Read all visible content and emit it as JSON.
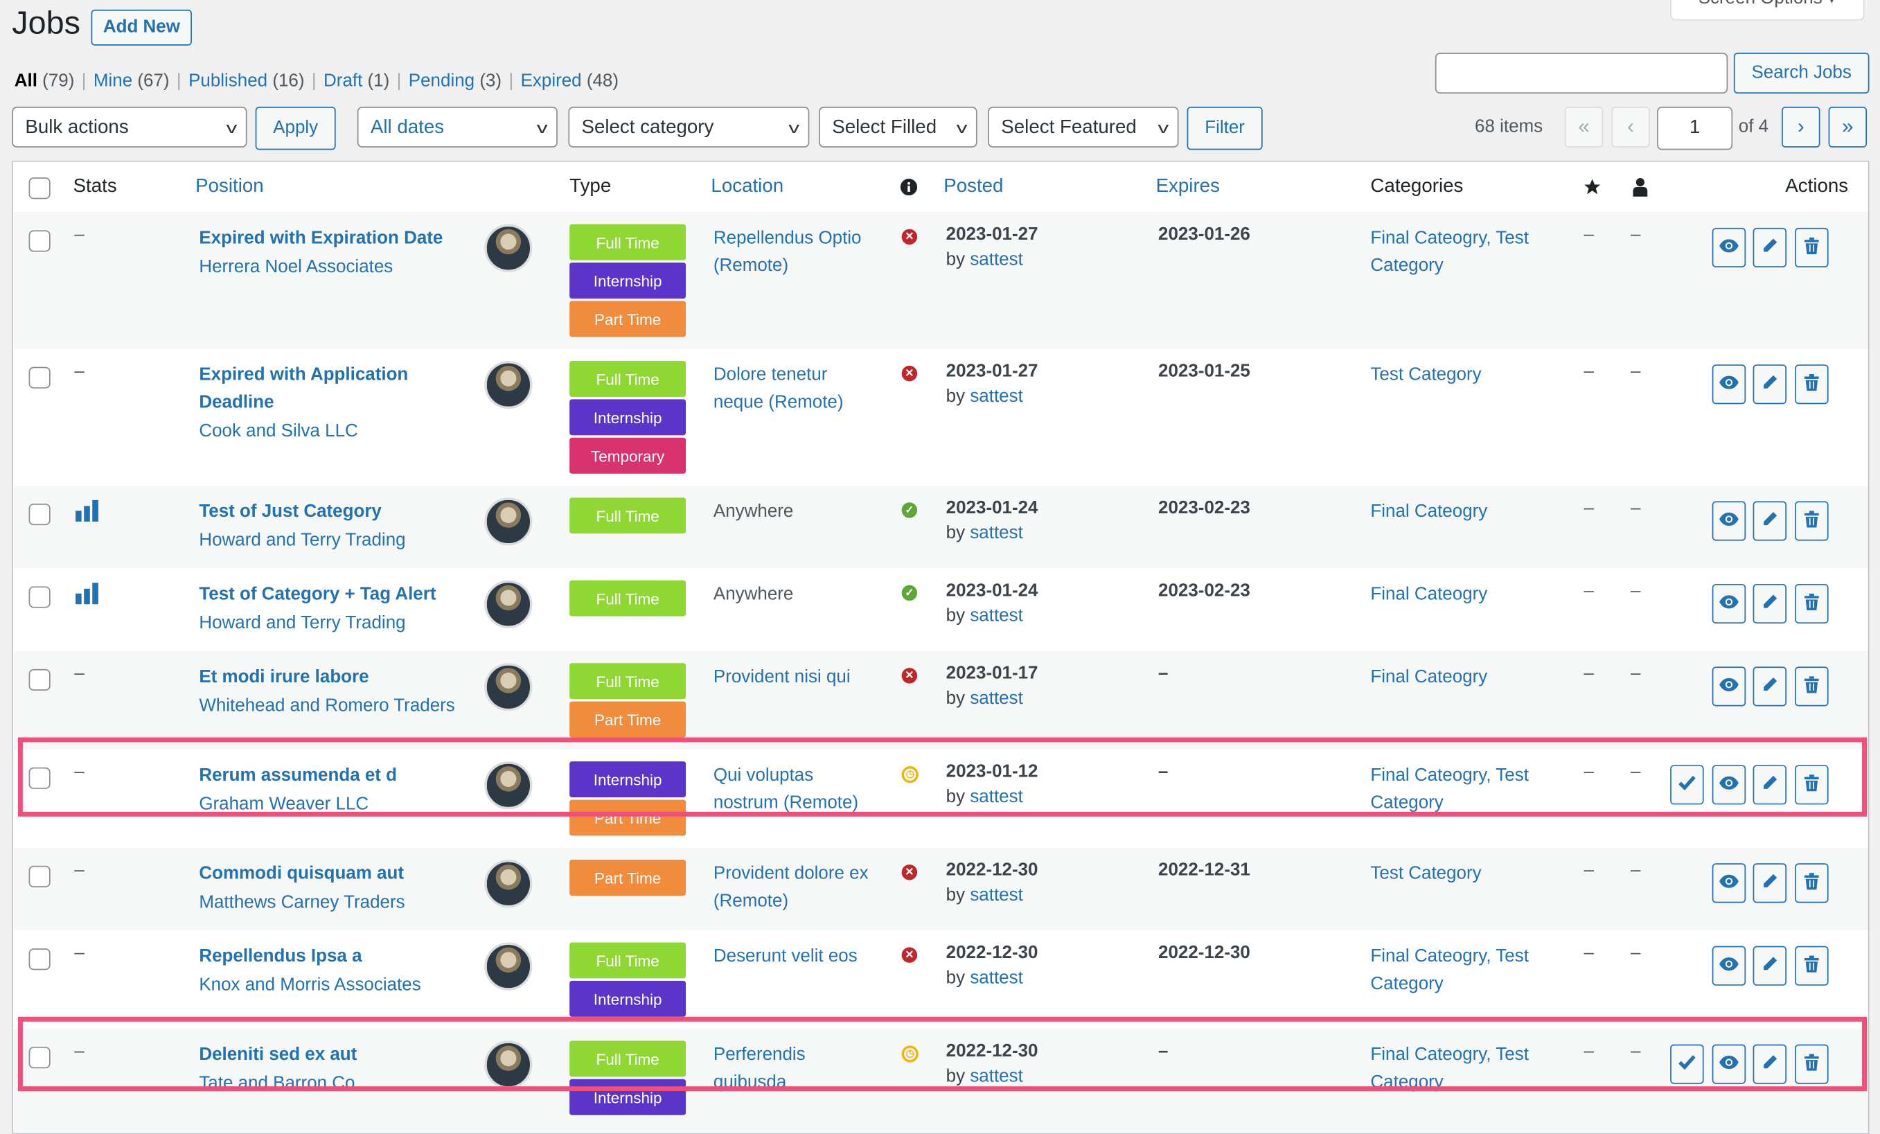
{
  "header": {
    "title": "Jobs",
    "add_new": "Add New",
    "screen_options": "Screen Options ▾"
  },
  "views": [
    {
      "label": "All",
      "count": "(79)",
      "current": true
    },
    {
      "label": "Mine",
      "count": "(67)"
    },
    {
      "label": "Published",
      "count": "(16)"
    },
    {
      "label": "Draft",
      "count": "(1)"
    },
    {
      "label": "Pending",
      "count": "(3)"
    },
    {
      "label": "Expired",
      "count": "(48)"
    }
  ],
  "search": {
    "value": "",
    "button": "Search Jobs"
  },
  "filters": {
    "bulk_actions": "Bulk actions",
    "apply": "Apply",
    "dates": "All dates",
    "category": "Select category",
    "filled": "Select Filled",
    "featured": "Select Featured",
    "filter": "Filter"
  },
  "pagination": {
    "items": "68 items",
    "first": "«",
    "prev": "‹",
    "current_page": "1",
    "of": "of 4",
    "next": "›",
    "last": "»"
  },
  "columns": {
    "stats": "Stats",
    "position": "Position",
    "type": "Type",
    "location": "Location",
    "status_icon": "info-icon",
    "posted": "Posted",
    "expires": "Expires",
    "categories": "Categories",
    "featured_icon": "star-icon",
    "filled_icon": "person-icon",
    "actions": "Actions"
  },
  "type_colors": {
    "Full Time": "#8fd834",
    "Internship": "#5b34c9",
    "Part Time": "#f08c3c",
    "Temporary": "#d9336f"
  },
  "status_colors": {
    "expired": "#c1262a",
    "active": "#5ea63a",
    "pending": "#f0b30a"
  },
  "highlight_color": "#ef4f79",
  "rows": [
    {
      "stats": "dash",
      "title": "Expired with Expiration Date",
      "company": "Herrera Noel Associates",
      "types": [
        "Full Time",
        "Internship",
        "Part Time"
      ],
      "location": "Repellendus Optio (Remote)",
      "location_link": true,
      "status": "expired",
      "posted": "2023-01-27",
      "by": "by",
      "author": "sattest",
      "expires": "2023-01-26",
      "categories": "Final Cateogry, Test Category",
      "featured": "–",
      "filled": "–",
      "pending": false
    },
    {
      "stats": "dash",
      "title": "Expired with Application Deadline",
      "company": "Cook and Silva LLC",
      "types": [
        "Full Time",
        "Internship",
        "Temporary"
      ],
      "location": "Dolore tenetur neque (Remote)",
      "location_link": true,
      "status": "expired",
      "posted": "2023-01-27",
      "by": "by",
      "author": "sattest",
      "expires": "2023-01-25",
      "categories": "Test Category",
      "featured": "–",
      "filled": "–",
      "pending": false
    },
    {
      "stats": "chart",
      "title": "Test of Just Category",
      "company": "Howard and Terry Trading",
      "types": [
        "Full Time"
      ],
      "location": "Anywhere",
      "location_link": false,
      "status": "active",
      "posted": "2023-01-24",
      "by": "by",
      "author": "sattest",
      "expires": "2023-02-23",
      "categories": "Final Cateogry",
      "featured": "–",
      "filled": "–",
      "pending": false
    },
    {
      "stats": "chart",
      "title": "Test of Category + Tag Alert",
      "company": "Howard and Terry Trading",
      "types": [
        "Full Time"
      ],
      "location": "Anywhere",
      "location_link": false,
      "status": "active",
      "posted": "2023-01-24",
      "by": "by",
      "author": "sattest",
      "expires": "2023-02-23",
      "categories": "Final Cateogry",
      "featured": "–",
      "filled": "–",
      "pending": false
    },
    {
      "stats": "dash",
      "title": "Et modi irure labore",
      "company": "Whitehead and Romero Traders",
      "types": [
        "Full Time",
        "Part Time"
      ],
      "location": "Provident nisi qui",
      "location_link": true,
      "status": "expired",
      "posted": "2023-01-17",
      "by": "by",
      "author": "sattest",
      "expires": "–",
      "categories": "Final Cateogry",
      "featured": "–",
      "filled": "–",
      "pending": false
    },
    {
      "stats": "dash",
      "title": "Rerum assumenda et d",
      "company": "Graham Weaver LLC",
      "types": [
        "Internship",
        "Part Time"
      ],
      "location": "Qui voluptas nostrum (Remote)",
      "location_link": true,
      "status": "pending",
      "posted": "2023-01-12",
      "by": "by",
      "author": "sattest",
      "expires": "–",
      "categories": "Final Cateogry, Test Category",
      "featured": "–",
      "filled": "–",
      "pending": true
    },
    {
      "stats": "dash",
      "title": "Commodi quisquam aut",
      "company": "Matthews Carney Traders",
      "types": [
        "Part Time"
      ],
      "location": "Provident dolore ex (Remote)",
      "location_link": true,
      "status": "expired",
      "posted": "2022-12-30",
      "by": "by",
      "author": "sattest",
      "expires": "2022-12-31",
      "categories": "Test Category",
      "featured": "–",
      "filled": "–",
      "pending": false
    },
    {
      "stats": "dash",
      "title": "Repellendus Ipsa a",
      "company": "Knox and Morris Associates",
      "types": [
        "Full Time",
        "Internship"
      ],
      "location": "Deserunt velit eos",
      "location_link": true,
      "status": "expired",
      "posted": "2022-12-30",
      "by": "by",
      "author": "sattest",
      "expires": "2022-12-30",
      "categories": "Final Cateogry, Test Category",
      "featured": "–",
      "filled": "–",
      "pending": false
    },
    {
      "stats": "dash",
      "title": "Deleniti sed ex aut",
      "company": "Tate and Barron Co",
      "types": [
        "Full Time",
        "Internship"
      ],
      "location": "Perferendis quibusda",
      "location_link": true,
      "status": "pending",
      "posted": "2022-12-30",
      "by": "by",
      "author": "sattest",
      "expires": "–",
      "categories": "Final Cateogry, Test Category",
      "featured": "–",
      "filled": "–",
      "pending": true
    }
  ]
}
